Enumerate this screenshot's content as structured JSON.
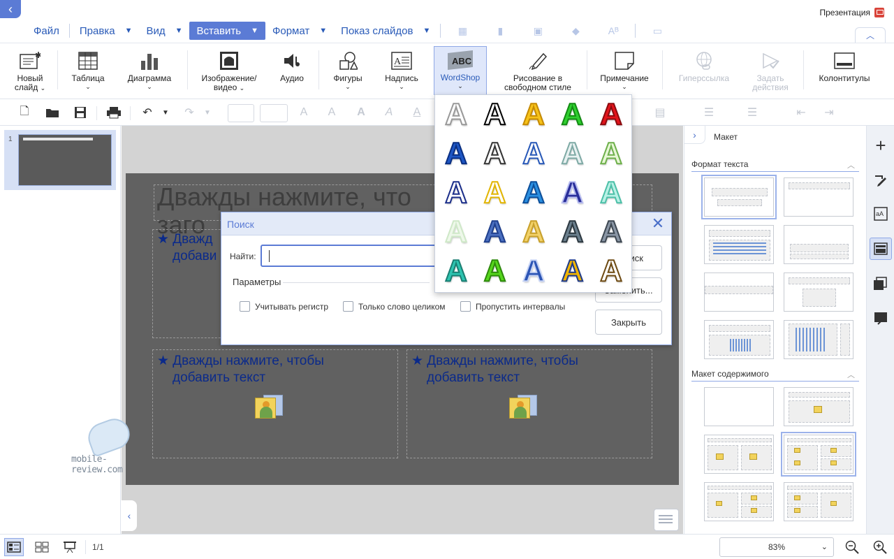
{
  "app": {
    "document_title": "Презентация",
    "back_glyph": "‹"
  },
  "menu": {
    "items": [
      {
        "label": "Файл",
        "has_chevron": false
      },
      {
        "label": "Правка",
        "has_chevron": true
      },
      {
        "label": "Вид",
        "has_chevron": true
      },
      {
        "label": "Вставить",
        "has_chevron": true,
        "active": true
      },
      {
        "label": "Формат",
        "has_chevron": true
      },
      {
        "label": "Показ слайдов",
        "has_chevron": true
      }
    ],
    "quick_icons": [
      "table-icon",
      "chart-icon",
      "image-icon",
      "shapes-icon",
      "text-style-icon",
      "textbox-icon"
    ],
    "collapse_glyph": "︿"
  },
  "ribbon": {
    "new_slide": {
      "line1": "Новый",
      "line2": "слайд"
    },
    "table": "Таблица",
    "chart": "Диаграмма",
    "image_video": {
      "line1": "Изображение/",
      "line2": "видео"
    },
    "audio": "Аудио",
    "shapes": "Фигуры",
    "caption": "Надпись",
    "wordshop": "WordShop",
    "wordshop_icon_text": "ABC",
    "freehand": {
      "line1": "Рисование в",
      "line2": "свободном стиле"
    },
    "note": "Примечание",
    "hyperlink": "Гиперссылка",
    "actions": {
      "line1": "Задать",
      "line2": "действия"
    },
    "header_footer": "Колонтитулы"
  },
  "format_toolbar": {
    "undo_glyph": "↶",
    "redo_glyph": "↷"
  },
  "slide_panel": {
    "thumb_number": "1"
  },
  "slide": {
    "title_placeholder": "Дважды нажмите, что",
    "title_line2": "заго",
    "placeholder_text": "★ Дважды нажмите, чтобы",
    "placeholder_text2": "добавить текст",
    "top_left_line1": "★ Дважд",
    "top_left_line2": "добави"
  },
  "watermark": {
    "text": "mobile-review.com"
  },
  "search_dialog": {
    "title": "Поиск",
    "find_label": "Найти:",
    "find_value": "",
    "params_label": "Параметры",
    "options": [
      {
        "label": "Учитывать регистр",
        "checked": false
      },
      {
        "label": "Только слово целиком",
        "checked": false
      },
      {
        "label": "Пропустить интервалы",
        "checked": false
      }
    ],
    "buttons": {
      "search": "иск",
      "replace": "Заменить...",
      "close": "Закрыть"
    },
    "close_glyph": "✕"
  },
  "wordshop_gallery": {
    "glyph": "A",
    "styles": [
      {
        "fill": "#ffffff",
        "stroke": "#999999"
      },
      {
        "fill": "#ffffff",
        "stroke": "#000000"
      },
      {
        "fill": "#f6c21a",
        "stroke": "#c68a00"
      },
      {
        "fill": "#2fcf2f",
        "stroke": "#138b13"
      },
      {
        "fill": "#e2141b",
        "stroke": "#8a0b0f"
      },
      {
        "fill": "#1e56c4",
        "stroke": "#0a2f82"
      },
      {
        "fill": "#ffffff",
        "stroke": "#333333"
      },
      {
        "fill": "#ffffff",
        "stroke": "#2758b8"
      },
      {
        "fill": "#e8f1f1",
        "stroke": "#7eaaa5"
      },
      {
        "fill": "#e7f7d6",
        "stroke": "#6db04a"
      },
      {
        "fill": "#ffffff",
        "stroke": "#1b2e8a"
      },
      {
        "fill": "#ffffff",
        "stroke": "#e2b500"
      },
      {
        "fill": "#2b8fe0",
        "stroke": "#0b4e9a"
      },
      {
        "fill": "#2a2f9a",
        "stroke": "#b8bdf0"
      },
      {
        "fill": "#b9f1e6",
        "stroke": "#4cc0a8"
      },
      {
        "fill": "#eef8ea",
        "stroke": "#cfe8c8"
      },
      {
        "fill": "#4b6fbf",
        "stroke": "#1f3f8d"
      },
      {
        "fill": "#f2d168",
        "stroke": "#c8a02a"
      },
      {
        "fill": "#6b7f8d",
        "stroke": "#2c3840"
      },
      {
        "fill": "#8a96a5",
        "stroke": "#3e4852"
      },
      {
        "fill": "#2ec4b0",
        "stroke": "#1a7f73"
      },
      {
        "fill": "#56d61d",
        "stroke": "#2e8a0c"
      },
      {
        "fill": "#2c55b5",
        "stroke": "#c7d4f5"
      },
      {
        "fill": "#f0b400",
        "stroke": "#1e3a8a"
      },
      {
        "fill": "#ffffff",
        "stroke": "#6e4a12"
      }
    ]
  },
  "right_panel": {
    "title": "Макет",
    "section_text_format": "Формат текста",
    "section_content_layout": "Макет содержимого",
    "collapse_glyph": "›"
  },
  "right_tools": [
    "add-icon",
    "edit-icon",
    "text-format-icon",
    "layout-icon",
    "transition-icon",
    "notes-icon"
  ],
  "status_bar": {
    "page_count": "1/1",
    "zoom": "83%"
  },
  "colors": {
    "accent": "#5b7bd5",
    "menu_text": "#2a5bb8",
    "slide_background": "#616161",
    "placeholder_text": "#0b2a8a"
  }
}
